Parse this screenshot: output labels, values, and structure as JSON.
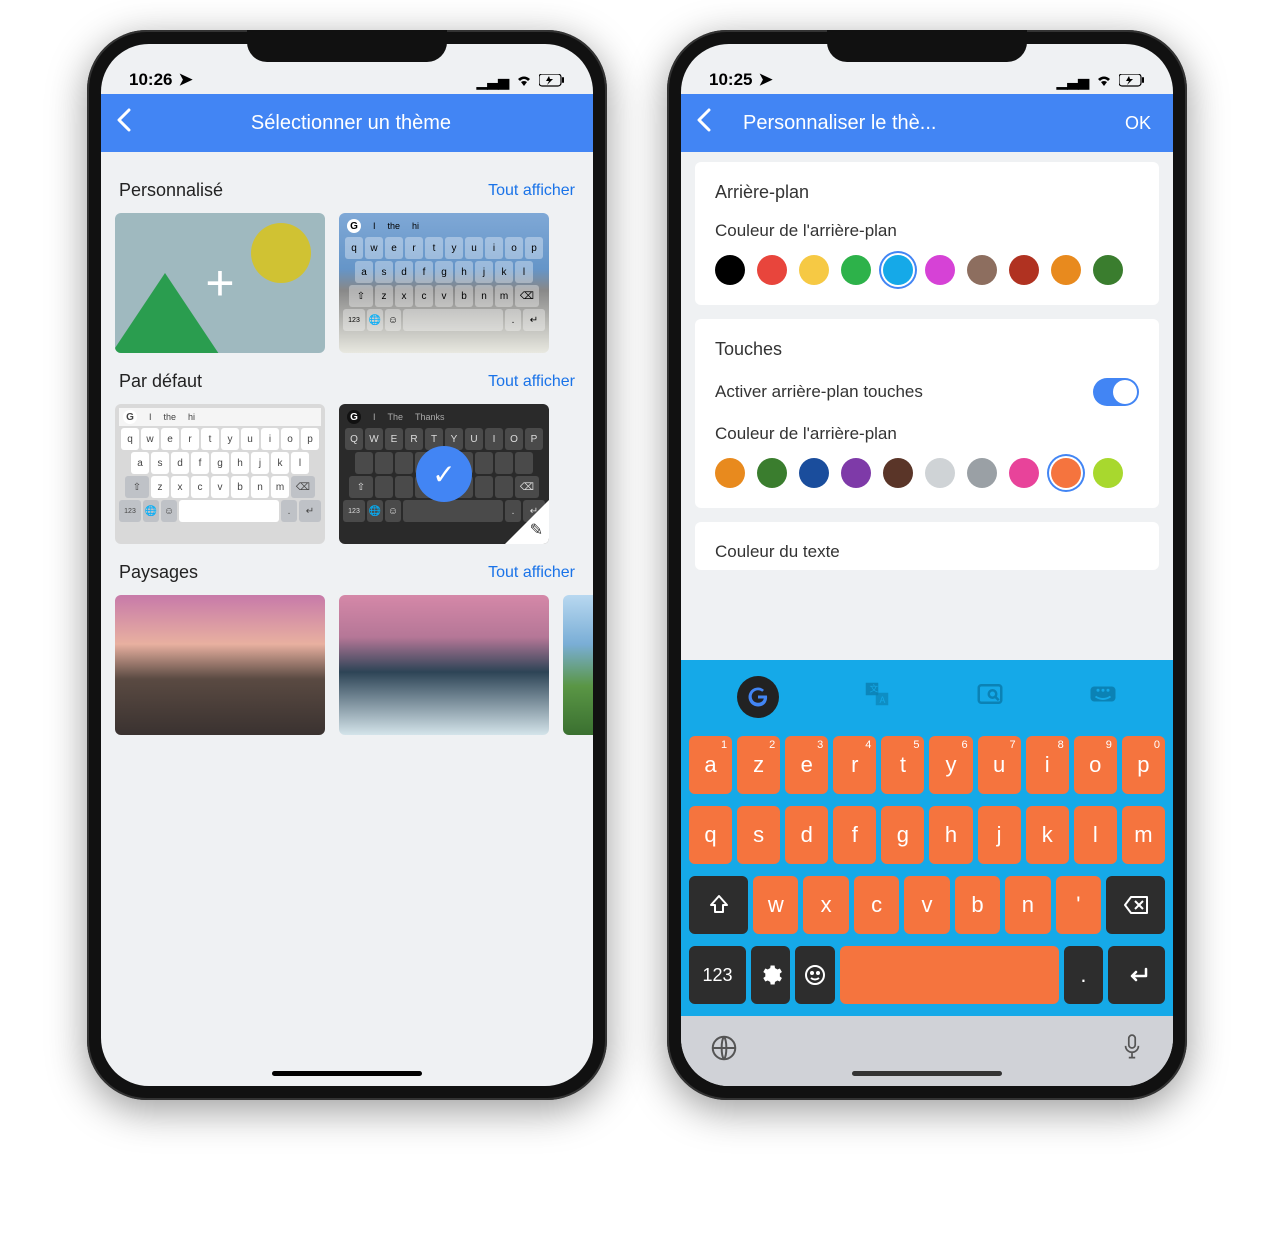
{
  "phone1": {
    "status": {
      "time": "10:26",
      "location_icon": "location-arrow",
      "signal": "signal",
      "wifi": "wifi",
      "battery": "battery-charging"
    },
    "nav": {
      "title": "Sélectionner un thème"
    },
    "sections": {
      "custom": {
        "title": "Personnalisé",
        "action": "Tout afficher"
      },
      "default": {
        "title": "Par défaut",
        "action": "Tout afficher"
      },
      "landscapes": {
        "title": "Paysages",
        "action": "Tout afficher"
      }
    },
    "kbd_light": {
      "suggestions": [
        "I",
        "the",
        "hi"
      ],
      "row1": [
        "q",
        "w",
        "e",
        "r",
        "t",
        "y",
        "u",
        "i",
        "o",
        "p"
      ],
      "row2": [
        "a",
        "s",
        "d",
        "f",
        "g",
        "h",
        "j",
        "k",
        "l"
      ],
      "row3": [
        "z",
        "x",
        "c",
        "v",
        "b",
        "n",
        "m"
      ]
    },
    "kbd_dark": {
      "suggestions": [
        "I",
        "The",
        "Thanks"
      ],
      "row1": [
        "Q",
        "W",
        "E",
        "R",
        "T",
        "Y",
        "U",
        "I",
        "O",
        "P"
      ]
    }
  },
  "phone2": {
    "status": {
      "time": "10:25"
    },
    "nav": {
      "title": "Personnaliser le thè...",
      "ok": "OK"
    },
    "background": {
      "title": "Arrière-plan",
      "color_label": "Couleur de l'arrière-plan",
      "colors": [
        "#000000",
        "#e8453c",
        "#f6c944",
        "#2db24a",
        "#15a9e8",
        "#d642d6",
        "#8d6e5f",
        "#b03221",
        "#e88a1e",
        "#3a7d2e"
      ],
      "selected_index": 4
    },
    "keys": {
      "title": "Touches",
      "enable_label": "Activer arrière-plan touches",
      "enable_value": true,
      "color_label": "Couleur de l'arrière-plan",
      "colors": [
        "#e88a1e",
        "#3a7d2e",
        "#1a4d9c",
        "#7e3aa8",
        "#5a3528",
        "#cfd3d6",
        "#9aa0a5",
        "#e8439a",
        "#f5743e",
        "#a8d82e"
      ],
      "selected_index": 8,
      "text_color_label": "Couleur du texte"
    },
    "keyboard": {
      "row1": [
        "a",
        "z",
        "e",
        "r",
        "t",
        "y",
        "u",
        "i",
        "o",
        "p"
      ],
      "row1_nums": [
        "1",
        "2",
        "3",
        "4",
        "5",
        "6",
        "7",
        "8",
        "9",
        "0"
      ],
      "row2": [
        "q",
        "s",
        "d",
        "f",
        "g",
        "h",
        "j",
        "k",
        "l",
        "m"
      ],
      "row3": [
        "w",
        "x",
        "c",
        "v",
        "b",
        "n",
        "'"
      ],
      "fn_123": "123",
      "fn_dot": "."
    }
  }
}
